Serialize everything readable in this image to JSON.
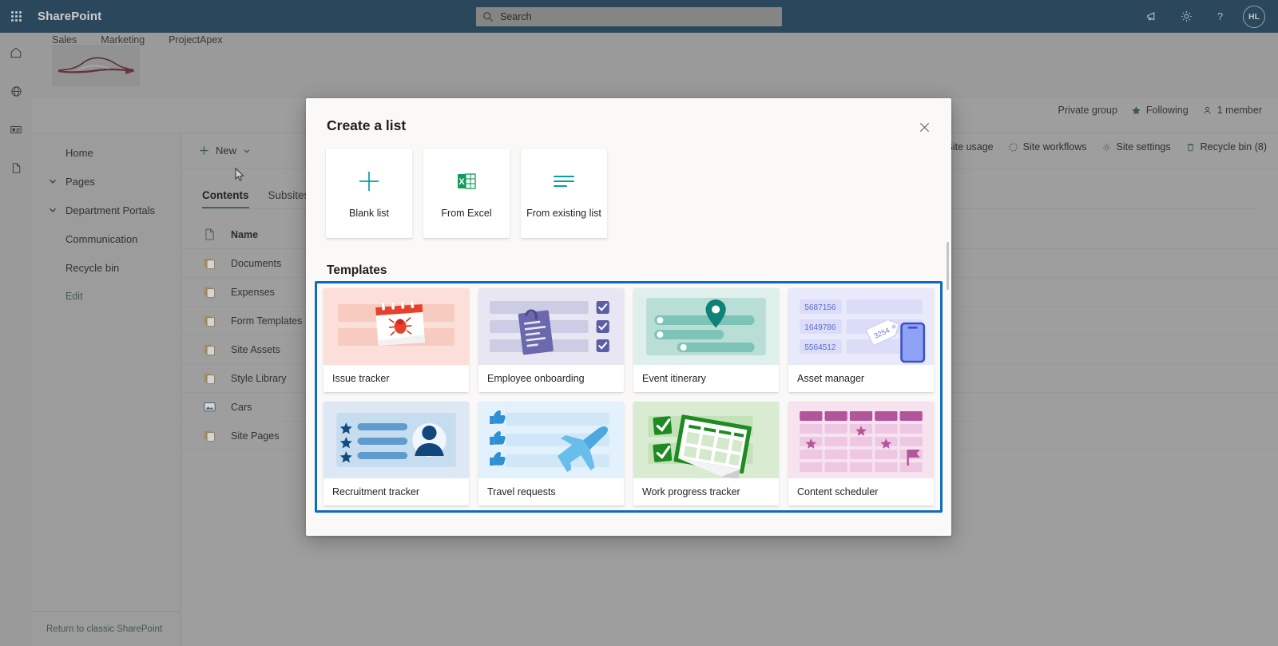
{
  "suite": {
    "waffle_label": "app-launcher",
    "title": "SharePoint",
    "search_placeholder": "Search",
    "actions": [
      "feedback",
      "settings",
      "help"
    ],
    "avatar_initials": "HL"
  },
  "rail": {
    "items": [
      {
        "name": "home-icon",
        "label": "Home"
      },
      {
        "name": "globe-icon",
        "label": "Sites"
      },
      {
        "name": "news-icon",
        "label": "News"
      },
      {
        "name": "file-icon",
        "label": "Files"
      }
    ]
  },
  "hub_nav": [
    "Sales",
    "Marketing",
    "ProjectApex"
  ],
  "group_info": {
    "privacy": "Private group",
    "following": "Following",
    "members": "1 member"
  },
  "left_nav": {
    "items": [
      {
        "label": "Home",
        "chevron": false,
        "style": "normal"
      },
      {
        "label": "Pages",
        "chevron": true,
        "style": "normal"
      },
      {
        "label": "Department Portals",
        "chevron": true,
        "style": "normal"
      },
      {
        "label": "Communication",
        "chevron": false,
        "style": "normal"
      },
      {
        "label": "Recycle bin",
        "chevron": false,
        "style": "normal"
      },
      {
        "label": "Edit",
        "chevron": false,
        "style": "edit"
      }
    ],
    "footer_link": "Return to classic SharePoint"
  },
  "command_bar": {
    "new_label": "New",
    "right_items": [
      {
        "label": "Site usage",
        "icon": "chart-icon"
      },
      {
        "label": "Site workflows",
        "icon": "workflow-icon"
      },
      {
        "label": "Site settings",
        "icon": "gear-icon"
      },
      {
        "label": "Recycle bin (8)",
        "icon": "trash-icon"
      }
    ]
  },
  "tabs": [
    {
      "label": "Contents",
      "selected": true
    },
    {
      "label": "Subsites",
      "selected": false
    }
  ],
  "contents_list": {
    "column_header": "Name",
    "rows": [
      {
        "name": "Documents",
        "icon": "list-icon"
      },
      {
        "name": "Expenses",
        "icon": "list-icon"
      },
      {
        "name": "Form Templates",
        "icon": "list-icon"
      },
      {
        "name": "Site Assets",
        "icon": "list-icon"
      },
      {
        "name": "Style Library",
        "icon": "list-icon"
      },
      {
        "name": "Cars",
        "icon": "picture-library-icon"
      },
      {
        "name": "Site Pages",
        "icon": "list-icon"
      }
    ]
  },
  "dialog": {
    "title": "Create a list",
    "close_label": "Close",
    "create_options": [
      {
        "label": "Blank list",
        "icon": "plus-icon"
      },
      {
        "label": "From Excel",
        "icon": "excel-icon"
      },
      {
        "label": "From existing list",
        "icon": "lines-icon"
      }
    ],
    "templates_heading": "Templates",
    "templates": [
      {
        "label": "Issue tracker",
        "art": "issue-tracker",
        "bg": "#fbdfd8"
      },
      {
        "label": "Employee onboarding",
        "art": "employee-onboarding",
        "bg": "#e7e6f2"
      },
      {
        "label": "Event itinerary",
        "art": "event-itinerary",
        "bg": "#dff0ec"
      },
      {
        "label": "Asset manager",
        "art": "asset-manager",
        "bg": "#e8eafb"
      },
      {
        "label": "Recruitment tracker",
        "art": "recruitment-tracker",
        "bg": "#dde8f4"
      },
      {
        "label": "Travel requests",
        "art": "travel-requests",
        "bg": "#e2f1fb"
      },
      {
        "label": "Work progress tracker",
        "art": "work-progress-tracker",
        "bg": "#d9ecd2"
      },
      {
        "label": "Content scheduler",
        "art": "content-scheduler",
        "bg": "#f7e3f0"
      }
    ],
    "asset_manager_ids": [
      "5687156",
      "1649786",
      "5564512"
    ],
    "asset_manager_tag": "3254"
  },
  "colors": {
    "suite_bar": "#03558e",
    "accent_teal": "#03787c",
    "focus_blue": "#0f6cbd",
    "excel_green": "#107c41",
    "edit_link": "#2a6b64"
  }
}
